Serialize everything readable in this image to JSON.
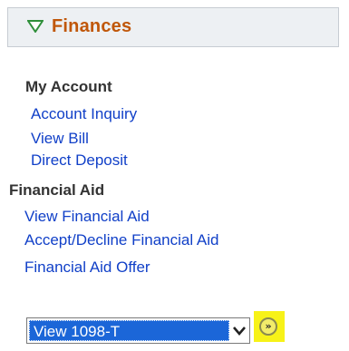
{
  "panel": {
    "title": "Finances"
  },
  "my_account": {
    "heading": "My Account",
    "links": [
      "Account Inquiry",
      "View Bill",
      "Direct Deposit"
    ]
  },
  "financial_aid": {
    "heading": "Financial Aid",
    "links": [
      "View Financial Aid",
      "Accept/Decline Financial Aid",
      "Financial Aid Offer"
    ]
  },
  "other_finances": {
    "selected": "View 1098-T",
    "go_label": "»"
  },
  "colors": {
    "title": "#c0570a",
    "link": "#1140c8",
    "select_highlight": "#1b66d8",
    "go_highlight": "#f7f218"
  },
  "icons": {
    "collapse": "triangle-down-icon",
    "dropdown": "chevron-down-icon",
    "go": "double-chevron-right-icon"
  }
}
